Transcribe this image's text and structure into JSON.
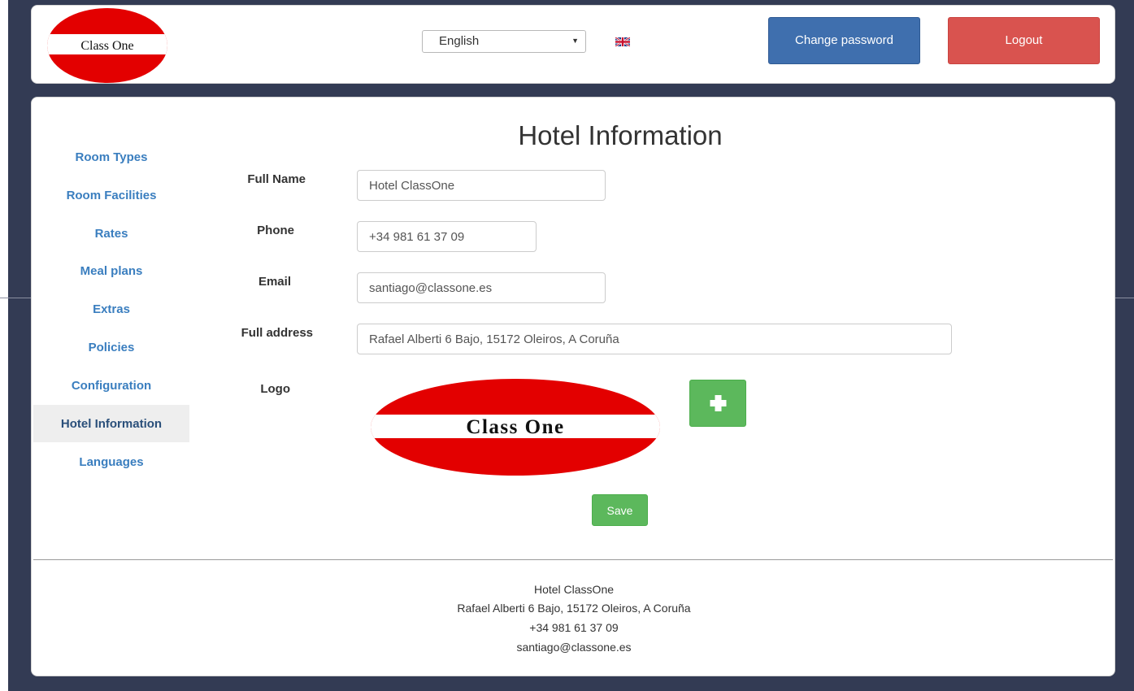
{
  "header": {
    "logo_text": "Class One",
    "language": {
      "selected": "English"
    },
    "flag_icon": "uk-flag-icon",
    "change_password_label": "Change password",
    "logout_label": "Logout"
  },
  "sidebar": {
    "items": [
      {
        "label": "Room Types",
        "active": false
      },
      {
        "label": "Room Facilities",
        "active": false
      },
      {
        "label": "Rates",
        "active": false
      },
      {
        "label": "Meal plans",
        "active": false
      },
      {
        "label": "Extras",
        "active": false
      },
      {
        "label": "Policies",
        "active": false
      },
      {
        "label": "Configuration",
        "active": false
      },
      {
        "label": "Hotel Information",
        "active": true
      },
      {
        "label": "Languages",
        "active": false
      }
    ]
  },
  "main": {
    "title": "Hotel Information",
    "form": {
      "full_name": {
        "label": "Full Name",
        "value": "Hotel ClassOne"
      },
      "phone": {
        "label": "Phone",
        "value": "+34 981 61 37 09"
      },
      "email": {
        "label": "Email",
        "value": "santiago@classone.es"
      },
      "address": {
        "label": "Full address",
        "value": "Rafael Alberti 6 Bajo, 15172 Oleiros, A Coruña"
      },
      "logo": {
        "label": "Logo",
        "logo_text": "Class One",
        "add_icon": "plus-icon"
      }
    },
    "save_label": "Save"
  },
  "footer": {
    "name": "Hotel ClassOne",
    "address": "Rafael Alberti 6 Bajo, 15172 Oleiros, A Coruña",
    "phone": "+34 981 61 37 09",
    "email": "santiago@classone.es"
  },
  "colors": {
    "background": "#333b54",
    "primary": "#3f6fae",
    "danger": "#d9534f",
    "success": "#5cb85c",
    "link": "#3a7ebf",
    "logo_red": "#e30000"
  }
}
